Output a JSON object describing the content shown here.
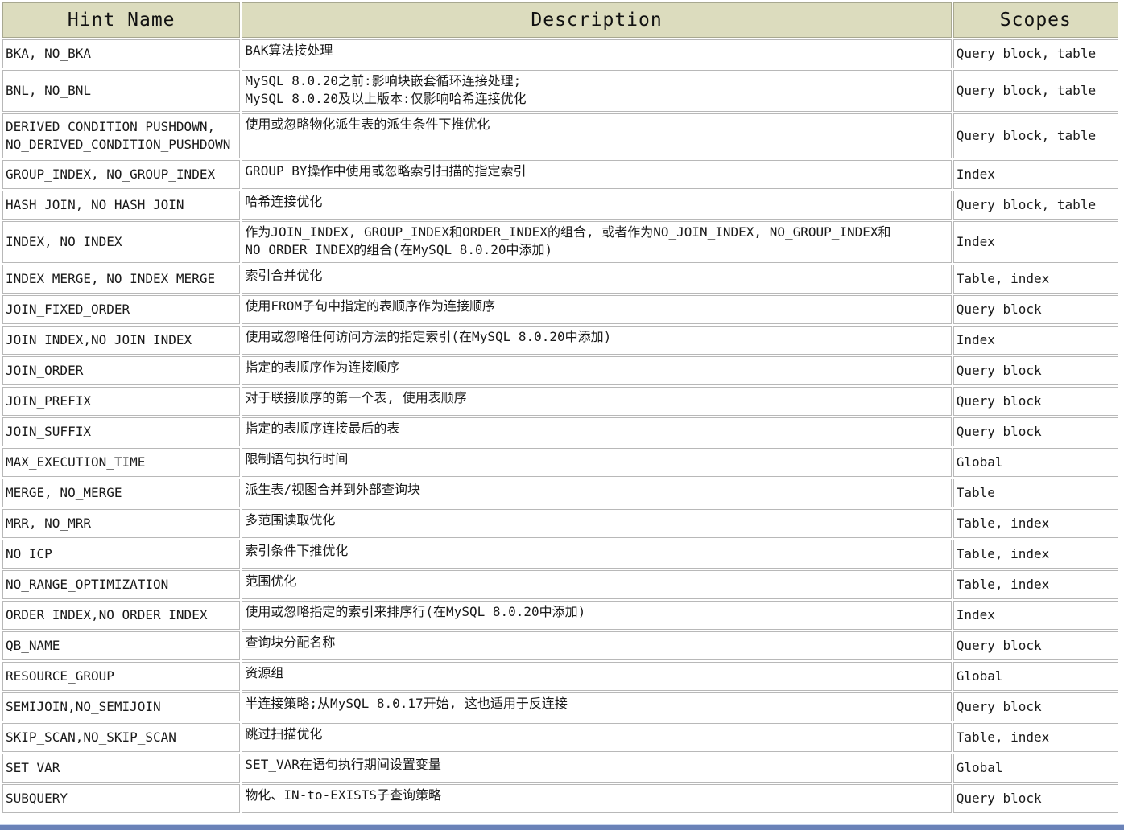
{
  "table": {
    "headers": [
      "Hint Name",
      "Description",
      "Scopes"
    ],
    "rows": [
      {
        "name": [
          "BKA, NO_BKA"
        ],
        "desc": [
          "BAK算法接处理"
        ],
        "scope": "Query block, table"
      },
      {
        "name": [
          "BNL, NO_BNL"
        ],
        "desc": [
          "MySQL 8.0.20之前:影响块嵌套循环连接处理;",
          "MySQL 8.0.20及以上版本:仅影响哈希连接优化"
        ],
        "scope": "Query block, table"
      },
      {
        "name": [
          "DERIVED_CONDITION_PUSHDOWN,",
          "NO_DERIVED_CONDITION_PUSHDOWN"
        ],
        "desc": [
          "使用或忽略物化派生表的派生条件下推优化"
        ],
        "scope": "Query block, table"
      },
      {
        "name": [
          "GROUP_INDEX, NO_GROUP_INDEX"
        ],
        "desc": [
          "GROUP BY操作中使用或忽略索引扫描的指定索引"
        ],
        "scope": "Index"
      },
      {
        "name": [
          "HASH_JOIN, NO_HASH_JOIN"
        ],
        "desc": [
          "哈希连接优化"
        ],
        "scope": "Query block, table"
      },
      {
        "name": [
          "INDEX, NO_INDEX"
        ],
        "desc": [
          "作为JOIN_INDEX, GROUP_INDEX和ORDER_INDEX的组合, 或者作为NO_JOIN_INDEX, NO_GROUP_INDEX和",
          "NO_ORDER_INDEX的组合(在MySQL 8.0.20中添加)"
        ],
        "scope": "Index"
      },
      {
        "name": [
          "INDEX_MERGE, NO_INDEX_MERGE"
        ],
        "desc": [
          "索引合并优化"
        ],
        "scope": "Table, index"
      },
      {
        "name": [
          "JOIN_FIXED_ORDER"
        ],
        "desc": [
          "使用FROM子句中指定的表顺序作为连接顺序"
        ],
        "scope": "Query block"
      },
      {
        "name": [
          "JOIN_INDEX,NO_JOIN_INDEX"
        ],
        "desc": [
          "使用或忽略任何访问方法的指定索引(在MySQL 8.0.20中添加)"
        ],
        "scope": "Index"
      },
      {
        "name": [
          "JOIN_ORDER"
        ],
        "desc": [
          "指定的表顺序作为连接顺序"
        ],
        "scope": "Query block"
      },
      {
        "name": [
          "JOIN_PREFIX"
        ],
        "desc": [
          "对于联接顺序的第一个表, 使用表顺序"
        ],
        "scope": "Query block"
      },
      {
        "name": [
          "JOIN_SUFFIX"
        ],
        "desc": [
          "指定的表顺序连接最后的表"
        ],
        "scope": "Query block"
      },
      {
        "name": [
          "MAX_EXECUTION_TIME"
        ],
        "desc": [
          "限制语句执行时间"
        ],
        "scope": "Global"
      },
      {
        "name": [
          "MERGE, NO_MERGE"
        ],
        "desc": [
          "派生表/视图合并到外部查询块"
        ],
        "scope": "Table"
      },
      {
        "name": [
          "MRR, NO_MRR"
        ],
        "desc": [
          "多范围读取优化"
        ],
        "scope": "Table, index"
      },
      {
        "name": [
          "NO_ICP"
        ],
        "desc": [
          "索引条件下推优化"
        ],
        "scope": "Table, index"
      },
      {
        "name": [
          "NO_RANGE_OPTIMIZATION"
        ],
        "desc": [
          "范围优化"
        ],
        "scope": "Table, index"
      },
      {
        "name": [
          "ORDER_INDEX,NO_ORDER_INDEX"
        ],
        "desc": [
          "使用或忽略指定的索引来排序行(在MySQL 8.0.20中添加)"
        ],
        "scope": "Index"
      },
      {
        "name": [
          "QB_NAME"
        ],
        "desc": [
          "查询块分配名称"
        ],
        "scope": "Query block"
      },
      {
        "name": [
          "RESOURCE_GROUP"
        ],
        "desc": [
          "资源组"
        ],
        "scope": "Global"
      },
      {
        "name": [
          "SEMIJOIN,NO_SEMIJOIN"
        ],
        "desc": [
          "半连接策略;从MySQL 8.0.17开始, 这也适用于反连接"
        ],
        "scope": "Query block"
      },
      {
        "name": [
          "SKIP_SCAN,NO_SKIP_SCAN"
        ],
        "desc": [
          "跳过扫描优化"
        ],
        "scope": "Table, index"
      },
      {
        "name": [
          "SET_VAR"
        ],
        "desc": [
          "SET_VAR在语句执行期间设置变量"
        ],
        "scope": "Global"
      },
      {
        "name": [
          "SUBQUERY"
        ],
        "desc": [
          "物化、IN-to-EXISTS子查询策略"
        ],
        "scope": "Query block"
      }
    ]
  },
  "colors": {
    "header_bg": "#dcdcbe",
    "cell_border": "#b8b8b8",
    "bottom_bar": "#6a82b8"
  }
}
